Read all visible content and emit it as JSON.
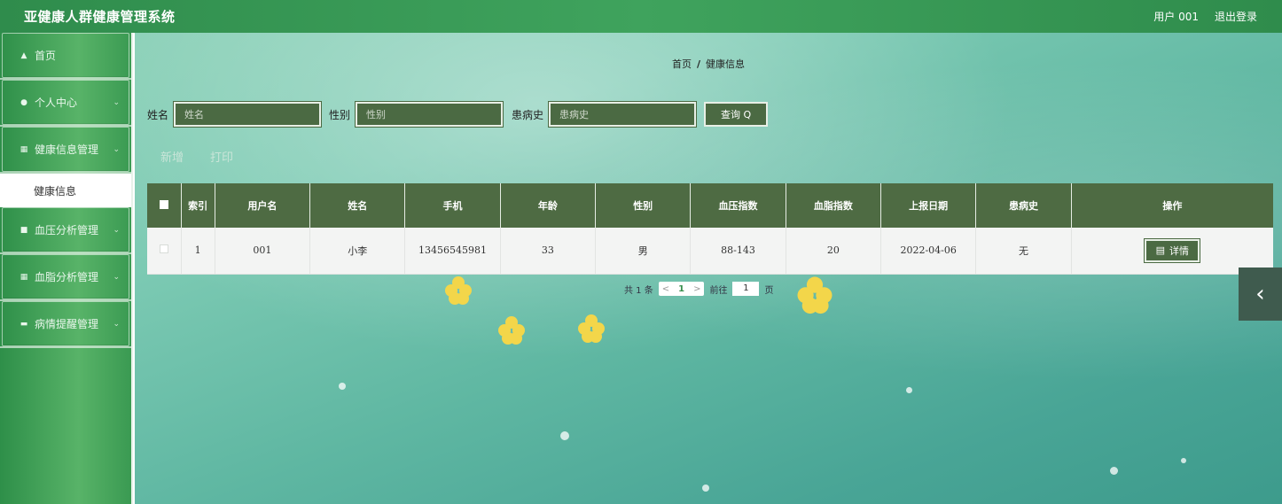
{
  "header": {
    "title": "亚健康人群健康管理系统",
    "user_label": "用户 001",
    "logout_label": "退出登录"
  },
  "sidebar": {
    "items": [
      {
        "label": "首页",
        "icon": "home-icon"
      },
      {
        "label": "个人中心",
        "icon": "user-icon"
      },
      {
        "label": "健康信息管理",
        "icon": "grid-icon"
      },
      {
        "label": "血压分析管理",
        "icon": "clipboard-icon"
      },
      {
        "label": "血脂分析管理",
        "icon": "grid-icon"
      },
      {
        "label": "病情提醒管理",
        "icon": "message-icon"
      }
    ],
    "sub_item": "健康信息"
  },
  "breadcrumb": {
    "home": "首页",
    "sep": "/",
    "current": "健康信息"
  },
  "search": {
    "name_label": "姓名",
    "name_placeholder": "姓名",
    "gender_label": "性别",
    "gender_placeholder": "性别",
    "history_label": "患病史",
    "history_placeholder": "患病史",
    "button": "查询 Q"
  },
  "actions": {
    "add": "新增",
    "print": "打印"
  },
  "table": {
    "headers": [
      "索引",
      "用户名",
      "姓名",
      "手机",
      "年龄",
      "性别",
      "血压指数",
      "血脂指数",
      "上报日期",
      "患病史",
      "操作"
    ],
    "rows": [
      {
        "index": "1",
        "username": "001",
        "name": "小李",
        "phone": "13456545981",
        "age": "33",
        "gender": "男",
        "bp": "88-143",
        "lipid": "20",
        "date": "2022-04-06",
        "history": "无",
        "action": "详情"
      }
    ]
  },
  "pager": {
    "total": "共 1 条",
    "prev": "<",
    "page": "1",
    "next": ">",
    "goto": "前往",
    "goto_value": "1",
    "unit": "页"
  },
  "colors": {
    "header_green": "#3fa35d",
    "table_head": "#4e6b43",
    "button": "#4b6a43"
  }
}
